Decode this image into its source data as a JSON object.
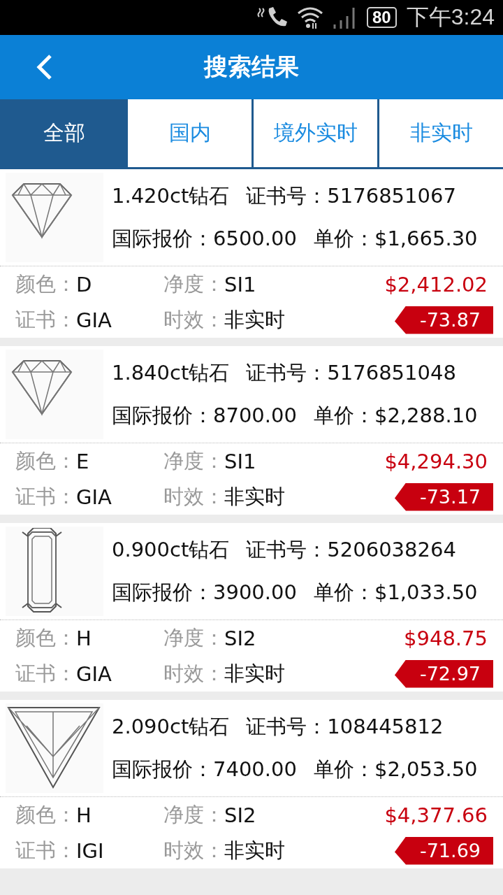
{
  "status_bar": {
    "battery": "80",
    "time": "下午3:24"
  },
  "header": {
    "title": "搜索结果"
  },
  "tabs": [
    {
      "label": "全部",
      "selected": true
    },
    {
      "label": "国内",
      "selected": false
    },
    {
      "label": "境外实时",
      "selected": false
    },
    {
      "label": "非实时",
      "selected": false
    }
  ],
  "results": [
    {
      "kind": "round",
      "title": "1.420ct钻石",
      "cert_no": "证书号：5176851067",
      "intl_price": "国际报价：6500.00",
      "unit_price": "单价：$1,665.30",
      "grade_label": "颜色：",
      "grade": "D",
      "clarity_label": "净度：",
      "clarity": "SI1",
      "price": "$2,412.02",
      "cert_label": "证书：",
      "cert": "GIA",
      "timing_label": "时效：",
      "timing": "非实时",
      "discount": "-73.87"
    },
    {
      "kind": "round",
      "title": "1.840ct钻石",
      "cert_no": "证书号：5176851048",
      "intl_price": "国际报价：8700.00",
      "unit_price": "单价：$2,288.10",
      "grade_label": "颜色：",
      "grade": "E",
      "clarity_label": "净度：",
      "clarity": "SI1",
      "price": "$4,294.30",
      "cert_label": "证书：",
      "cert": "GIA",
      "timing_label": "时效：",
      "timing": "非实时",
      "discount": "-73.17"
    },
    {
      "kind": "emerald",
      "title": "0.900ct钻石",
      "cert_no": "证书号：5206038264",
      "intl_price": "国际报价：3900.00",
      "unit_price": "单价：$1,033.50",
      "grade_label": "颜色：",
      "grade": "H",
      "clarity_label": "净度：",
      "clarity": "SI2",
      "price": "$948.75",
      "cert_label": "证书：",
      "cert": "GIA",
      "timing_label": "时效：",
      "timing": "非实时",
      "discount": "-72.97"
    },
    {
      "kind": "trillion",
      "title": "2.090ct钻石",
      "cert_no": "证书号：108445812",
      "intl_price": "国际报价：7400.00",
      "unit_price": "单价：$2,053.50",
      "grade_label": "颜色：",
      "grade": "H",
      "clarity_label": "净度：",
      "clarity": "SI2",
      "price": "$4,377.66",
      "cert_label": "证书：",
      "cert": "IGI",
      "timing_label": "时效：",
      "timing": "非实时",
      "discount": "-71.69"
    }
  ]
}
